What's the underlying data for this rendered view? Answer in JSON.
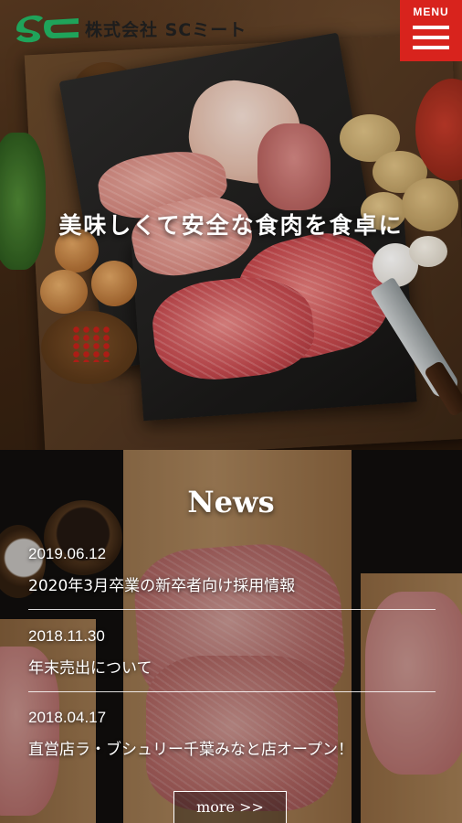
{
  "header": {
    "company_name": "株式会社 SCミート",
    "logo_text": "SC",
    "menu_label": "MENU",
    "accent_color": "#d8231d",
    "logo_color": "#1fa35a"
  },
  "hero": {
    "tagline": "美味しくて安全な食肉を食卓に"
  },
  "news": {
    "title": "News",
    "items": [
      {
        "date": "2019.06.12",
        "text": "2020年3月卒業の新卒者向け採用情報"
      },
      {
        "date": "2018.11.30",
        "text": "年末売出について"
      },
      {
        "date": "2018.04.17",
        "text": "直営店ラ・ブシュリー千葉みなと店オープン！"
      }
    ],
    "more_label": "more >>"
  }
}
